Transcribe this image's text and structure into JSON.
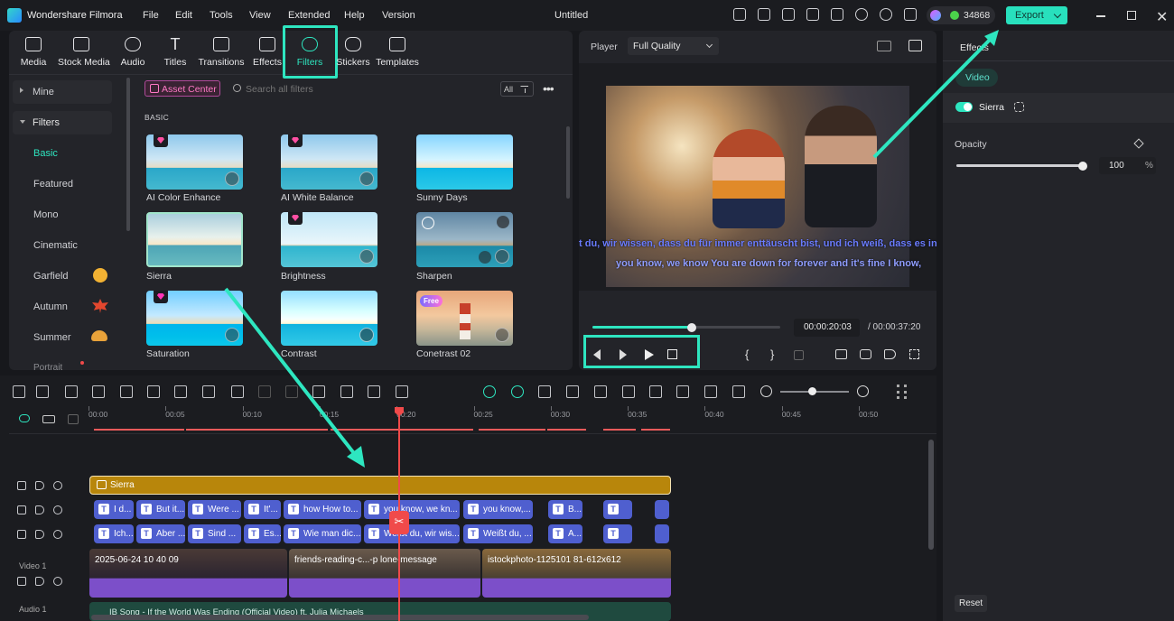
{
  "app": {
    "name": "Wondershare Filmora",
    "project_title": "Untitled",
    "credits": "34868",
    "export_label": "Export"
  },
  "menu": [
    "File",
    "Edit",
    "Tools",
    "View",
    "Extended",
    "Help",
    "Version"
  ],
  "toolbar": [
    {
      "label": "Media",
      "icon": "media-icon"
    },
    {
      "label": "Stock Media",
      "icon": "stock-media-icon"
    },
    {
      "label": "Audio",
      "icon": "audio-icon"
    },
    {
      "label": "Titles",
      "icon": "titles-icon"
    },
    {
      "label": "Transitions",
      "icon": "transitions-icon"
    },
    {
      "label": "Effects",
      "icon": "effects-icon"
    },
    {
      "label": "Filters",
      "icon": "filters-icon"
    },
    {
      "label": "Stickers",
      "icon": "stickers-icon"
    },
    {
      "label": "Templates",
      "icon": "templates-icon"
    }
  ],
  "sidebar": {
    "mine": "Mine",
    "filters": "Filters",
    "items": [
      "Basic",
      "Featured",
      "Mono",
      "Cinematic",
      "Garfield",
      "Autumn",
      "Summer",
      "Portrait"
    ]
  },
  "library": {
    "asset_center": "Asset Center",
    "search_placeholder": "Search all filters",
    "all_label": "All",
    "section": "BASIC"
  },
  "filters": [
    "AI Color Enhance",
    "AI White Balance",
    "Sunny Days",
    "Sierra",
    "Brightness",
    "Sharpen",
    "Saturation",
    "Contrast",
    "Conetrast 02"
  ],
  "free_badge": "Free",
  "player": {
    "label": "Player",
    "quality": "Full Quality",
    "current_time": "00:00:20:03",
    "total_time": "/ 00:00:37:20",
    "progress": 0.53,
    "subtitle_de": "t du, wir wissen, dass du für immer enttäuscht bist, und ich weiß, dass es in Ordnu",
    "subtitle_en": "you know, we know You are down for forever and it's fine I know,"
  },
  "inspector": {
    "tab": "Effects",
    "subtab": "Video",
    "filter_name": "Sierra",
    "opacity_label": "Opacity",
    "opacity_value": "100",
    "opacity_unit": "%",
    "opacity_level": 1.0,
    "reset_label": "Reset"
  },
  "timeline": {
    "ruler": [
      "00:00",
      "00:05",
      "00:10",
      "00:15",
      "00:20",
      "00:25",
      "00:30",
      "00:35",
      "00:40",
      "00:45",
      "00:50"
    ],
    "filter_clip": "Sierra",
    "sub_row1": [
      "I d...",
      "But it...",
      "Were ...",
      "It'...",
      "how How to...",
      "you know, we kn...",
      "you know,...",
      "B...",
      "",
      ""
    ],
    "sub_row2": [
      "Ich...",
      "Aber ...",
      "Sind ...",
      "Es...",
      "Wie man dic...",
      "Weißt du, wir wis...",
      "Weißt du, ...",
      "A...",
      "",
      ""
    ],
    "video_label": "Video 1",
    "audio_label": "Audio 1",
    "video_clips": [
      "2025-06-24 10 40 09",
      "friends-reading-c...-p lone-message",
      "istockphoto-1125101 81-612x612"
    ],
    "audio_clip": "IB Song - If the World Was Ending (Official Video) ft. Julia Michaels"
  },
  "colors": {
    "accent": "#2ee6c0",
    "export_bg": "#28e0bd",
    "filter_clip": "#b8860b",
    "subtitle_clip": "#4f5fcf",
    "playhead": "#f04a4a"
  }
}
